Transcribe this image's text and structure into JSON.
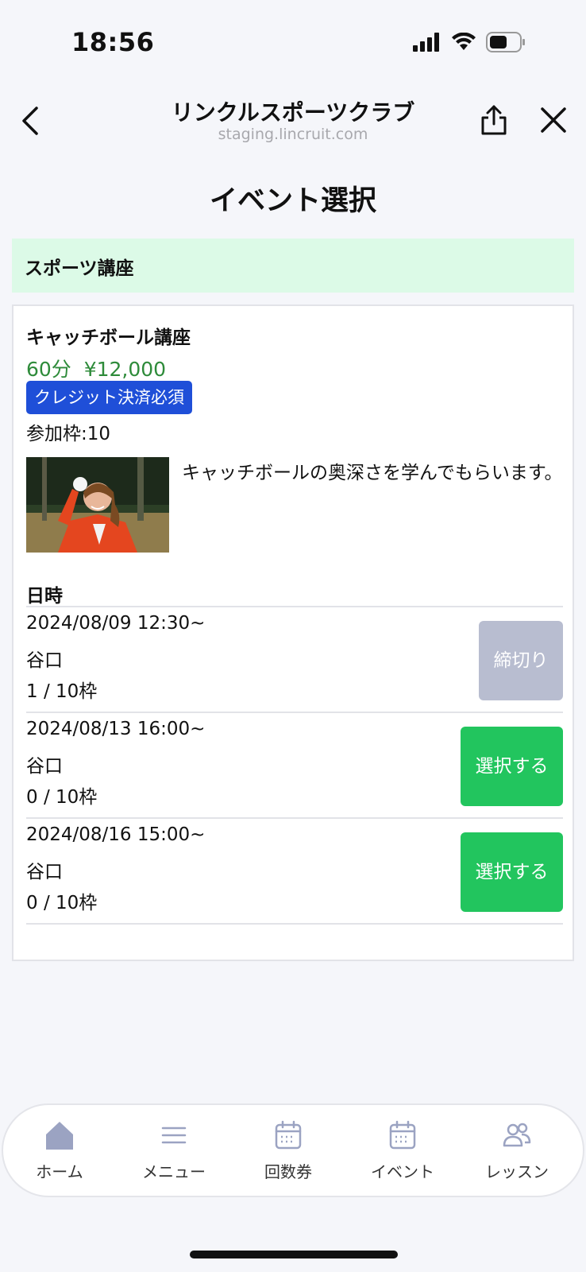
{
  "status": {
    "time": "18:56"
  },
  "browser": {
    "title": "リンクルスポーツクラブ",
    "url": "staging.lincruit.com"
  },
  "page": {
    "title": "イベント選択"
  },
  "category": {
    "label": "スポーツ講座"
  },
  "event": {
    "name": "キャッチボール講座",
    "price_line": "60分  ¥12,000",
    "badge": "クレジット決済必須",
    "capacity": "参加枠:10",
    "description": "キャッチボールの奥深さを学んでもらいます。",
    "datetime_heading": "日時",
    "slots": [
      {
        "date": "2024/08/09 12:30~",
        "host": "谷口",
        "count": "1 / 10枠",
        "button": "締切り",
        "state": "closed"
      },
      {
        "date": "2024/08/13 16:00~",
        "host": "谷口",
        "count": "0 / 10枠",
        "button": "選択する",
        "state": "open"
      },
      {
        "date": "2024/08/16 15:00~",
        "host": "谷口",
        "count": "0 / 10枠",
        "button": "選択する",
        "state": "open"
      }
    ]
  },
  "nav": {
    "items": [
      {
        "label": "ホーム",
        "icon": "home-icon"
      },
      {
        "label": "メニュー",
        "icon": "menu-icon"
      },
      {
        "label": "回数券",
        "icon": "calendar-icon"
      },
      {
        "label": "イベント",
        "icon": "calendar-icon"
      },
      {
        "label": "レッスン",
        "icon": "users-icon"
      }
    ]
  },
  "colors": {
    "accent_green": "#22c55e",
    "category_bg": "#dcfae7",
    "badge_blue": "#1f4fd8",
    "price_green": "#2e8b3a",
    "closed_gray": "#b8bdd0"
  }
}
